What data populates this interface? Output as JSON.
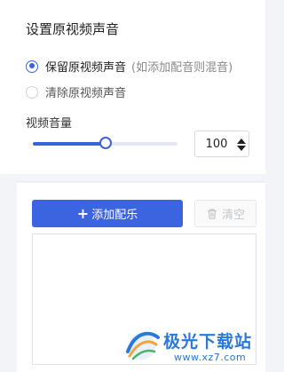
{
  "original_sound": {
    "title": "设置原视频声音",
    "options": [
      {
        "label": "保留原视频声音",
        "hint": "(如添加配音则混音)",
        "checked": true
      },
      {
        "label": "清除原视频声音",
        "hint": "",
        "checked": false
      }
    ]
  },
  "volume": {
    "label": "视频音量",
    "value": "100",
    "slider_fraction": 0.5
  },
  "music": {
    "add_label": "添加配乐",
    "clear_label": "清空",
    "items": []
  },
  "watermark": {
    "title": "极光下载站",
    "url": "www.xz7.com"
  },
  "colors": {
    "accent": "#3d64e0",
    "watermark_blue": "#2a78d8"
  }
}
